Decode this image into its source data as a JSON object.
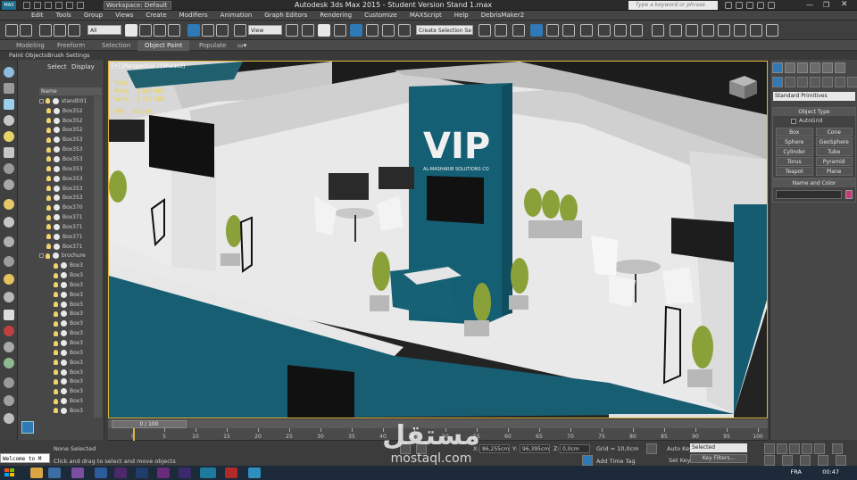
{
  "title_bar": {
    "app_logo": "MAX",
    "workspace_label": "Workspace: Default",
    "window_title": "Autodesk 3ds Max  2015  - Student Version    Stand 1.max",
    "search_placeholder": "Type a keyword or phrase"
  },
  "menu": [
    "Edit",
    "Tools",
    "Group",
    "Views",
    "Create",
    "Modifiers",
    "Animation",
    "Graph Editors",
    "Rendering",
    "Customize",
    "MAXScript",
    "Help",
    "DebrisMaker2"
  ],
  "toolbar": {
    "selection_filter": "All",
    "ref_coord": "View",
    "named_selection": "Create Selection Se"
  },
  "ribbon": {
    "tabs": [
      "Modeling",
      "Freeform",
      "Selection",
      "Object Paint",
      "Populate"
    ],
    "active_tab": "Object Paint",
    "sub_tabs": [
      "Paint Objects",
      "Brush Settings"
    ]
  },
  "scene_explorer": {
    "tabs": [
      "Select",
      "Display"
    ],
    "column_header": "Name",
    "items": [
      {
        "label": "stand001",
        "level": 0,
        "expand": true
      },
      {
        "label": "Box352",
        "level": 1
      },
      {
        "label": "Box352",
        "level": 1
      },
      {
        "label": "Box352",
        "level": 1
      },
      {
        "label": "Box353",
        "level": 1
      },
      {
        "label": "Box353",
        "level": 1
      },
      {
        "label": "Box353",
        "level": 1
      },
      {
        "label": "Box353",
        "level": 1
      },
      {
        "label": "Box353",
        "level": 1
      },
      {
        "label": "Box353",
        "level": 1
      },
      {
        "label": "Box353",
        "level": 1
      },
      {
        "label": "Box370",
        "level": 1
      },
      {
        "label": "Box371",
        "level": 1
      },
      {
        "label": "Box371",
        "level": 1
      },
      {
        "label": "Box371",
        "level": 1
      },
      {
        "label": "Box371",
        "level": 1
      },
      {
        "label": "brochure",
        "level": 0,
        "expand": true
      },
      {
        "label": "Box3",
        "level": 2
      },
      {
        "label": "Box3",
        "level": 2
      },
      {
        "label": "Box3",
        "level": 2
      },
      {
        "label": "Box3",
        "level": 2
      },
      {
        "label": "Box3",
        "level": 2
      },
      {
        "label": "Box3",
        "level": 2
      },
      {
        "label": "Box3",
        "level": 2
      },
      {
        "label": "Box3",
        "level": 2
      },
      {
        "label": "Box3",
        "level": 2
      },
      {
        "label": "Box3",
        "level": 2
      },
      {
        "label": "Box3",
        "level": 2
      },
      {
        "label": "Box3",
        "level": 2
      },
      {
        "label": "Box3",
        "level": 2
      },
      {
        "label": "Box3",
        "level": 2
      },
      {
        "label": "Box3",
        "level": 2
      },
      {
        "label": "Box3",
        "level": 2
      }
    ]
  },
  "viewport": {
    "label": "[+] [Perspective ] [Shaded]",
    "stats": [
      {
        "name": "Total",
        "value": ""
      },
      {
        "name": "Polys:",
        "value": "1 860 882"
      },
      {
        "name": "Verts:",
        "value": "1 127 588"
      },
      {
        "name": "FPS:",
        "value": "62.148"
      }
    ],
    "sign_text": "VIP",
    "sign_subtext": "AL-MASHARIB SOLUTIONS CO"
  },
  "command_panel": {
    "category": "Standard Primitives",
    "object_type_header": "Object Type",
    "autogrid_label": "AutoGrid",
    "object_buttons": [
      "Box",
      "Cone",
      "Sphere",
      "GeoSphere",
      "Cylinder",
      "Tube",
      "Torus",
      "Pyramid",
      "Teapot",
      "Plane"
    ],
    "name_color_header": "Name and Color",
    "swatch_color": "#c83a7b"
  },
  "timeline": {
    "frame_display": "0 / 100",
    "ruler_labels": [
      "0",
      "5",
      "10",
      "15",
      "20",
      "25",
      "30",
      "35",
      "40",
      "45",
      "50",
      "55",
      "60",
      "65",
      "70",
      "75",
      "80",
      "85",
      "90",
      "95",
      "100"
    ],
    "current_frame_fraction": 0.0
  },
  "status": {
    "maxscript_text": "Welcome to M",
    "selection_text": "None Selected",
    "prompt_text": "Click and drag to select and move objects",
    "x_label": "X:",
    "x_value": "86,255cm",
    "y_label": "Y:",
    "y_value": "96,395cm",
    "z_label": "Z:",
    "z_value": "0,0cm",
    "grid_label": "Grid = 10,0cm",
    "add_time_tag": "Add Time Tag",
    "auto_key": "Auto Key",
    "set_key": "Set Key",
    "selected_dropdown": "Selected",
    "key_filters": "Key Filters..."
  },
  "watermark": {
    "arabic": "مستقل",
    "latin": "mostaql.com"
  },
  "taskbar": {
    "language": "FRA",
    "clock": "00:47"
  }
}
